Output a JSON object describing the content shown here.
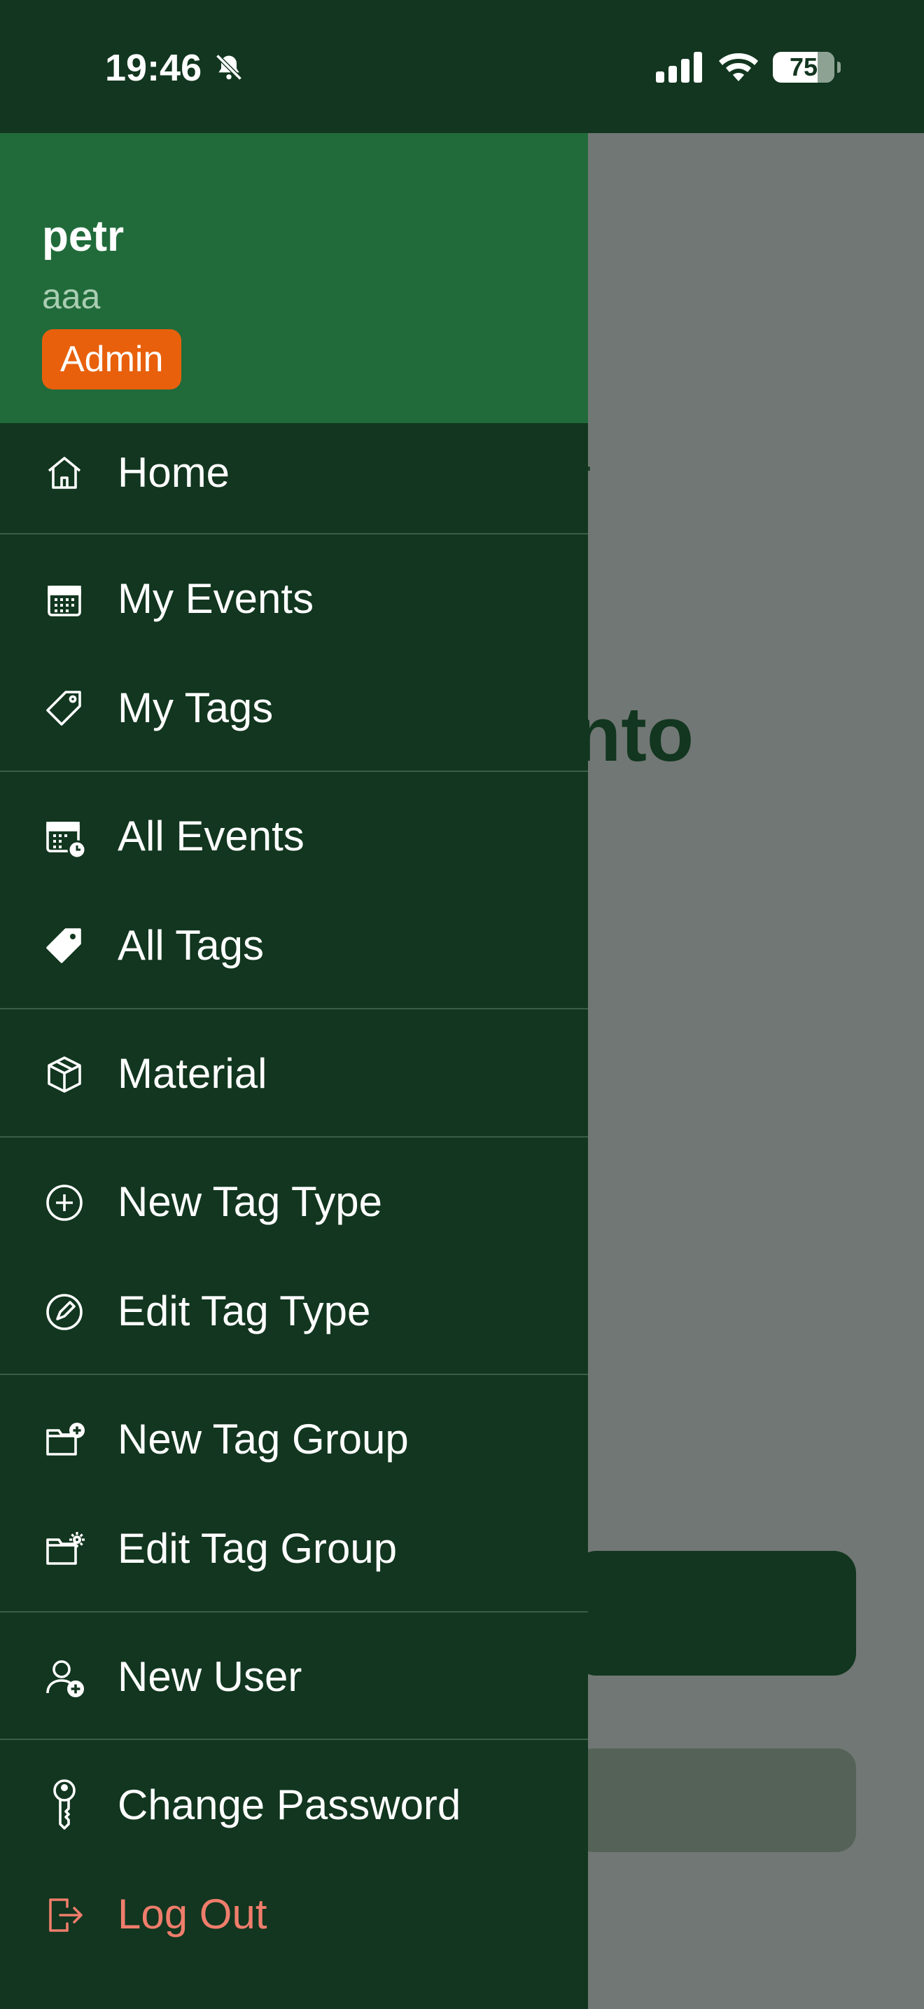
{
  "status_bar": {
    "time": "19:46",
    "battery": "75",
    "icons": [
      "bell-slash-icon",
      "cellular-signal-icon",
      "wifi-icon",
      "battery-icon"
    ]
  },
  "background": {
    "partial_text_1": "r",
    "partial_title": "nto"
  },
  "drawer": {
    "user": {
      "name": "petr",
      "subtitle": "aaa",
      "role": "Admin"
    },
    "items": [
      {
        "label": "Home",
        "icon": "home-icon"
      },
      {
        "label": "My Events",
        "icon": "calendar-icon"
      },
      {
        "label": "My Tags",
        "icon": "tag-outline-icon"
      },
      {
        "label": "All Events",
        "icon": "calendar-clock-icon"
      },
      {
        "label": "All Tags",
        "icon": "tag-filled-icon"
      },
      {
        "label": "Material",
        "icon": "box-icon"
      },
      {
        "label": "New Tag Type",
        "icon": "plus-circle-icon"
      },
      {
        "label": "Edit Tag Type",
        "icon": "edit-circle-icon"
      },
      {
        "label": "New Tag Group",
        "icon": "folder-plus-icon"
      },
      {
        "label": "Edit Tag Group",
        "icon": "folder-gear-icon"
      },
      {
        "label": "New User",
        "icon": "user-plus-icon"
      },
      {
        "label": "Change Password",
        "icon": "key-icon"
      },
      {
        "label": "Log Out",
        "icon": "logout-icon"
      }
    ]
  },
  "colors": {
    "drawer_bg": "#12361f",
    "header_bg": "#216b3b",
    "badge_bg": "#e8600c",
    "logout_text": "#f07d6c",
    "divider": "#3b5d45",
    "scrim": "#717774"
  }
}
